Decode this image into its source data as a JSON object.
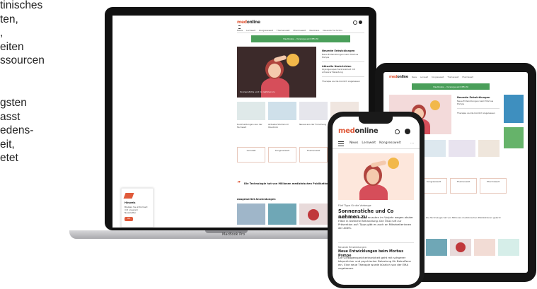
{
  "left_text": {
    "lines_top": [
      "tinisches",
      "ten,",
      ",",
      "eiten",
      "ssourcen"
    ],
    "lines_bottom": [
      "gsten",
      "asst",
      "edens-",
      "eit,",
      "etet"
    ]
  },
  "laptop": {
    "brand_a": "med",
    "brand_b": "online",
    "model_label": "MacBook Pro",
    "nav": [
      "News",
      "Lernwelt",
      "Kongresswelt",
      "Themenwelt",
      "Pharmawelt",
      "Webinare",
      "Neueste Fachinfos"
    ],
    "banner_text": "Hautkrebs – Vorsorge wird Pflicht",
    "quote_text": "Die Technologie hat von Millionen medizinischen Publikationen",
    "section_heading": "Ausgewertet Anwendungen",
    "chips": [
      "Lernwelt",
      "Kongresswelt",
      "Themenwelt",
      "Pharmawelt"
    ],
    "popup_title": "Hinweis",
    "popup_button": "OK"
  },
  "tablet": {
    "brand_a": "med",
    "brand_b": "online",
    "banner_text": "Hautkrebs – Vorsorge wird Pflicht",
    "chips": [
      "Kongresswelt",
      "Themenwelt",
      "Pharmawelt"
    ],
    "quote_text": "Die Technologie hat von Millionen medizinischen Publikationen gelernt"
  },
  "phone": {
    "brand_a": "med",
    "brand_b": "online",
    "nav": [
      "News",
      "Lernwelt",
      "Kongresswelt"
    ],
    "kicker": "Fünf Tipps für die Vorbeuge",
    "headline": "Sonnenstiche und Co nehmen zu",
    "body": "Rund 2.500 Personen mussten im Vorjahr wegen akuter Hitze in ärztliche Behandlung. Die ÖGA ruft zur Prävention auf: Tipps gibt es auch an Mitarbeiterinnen der AGES.",
    "kicker2": "Neueste Entwicklungen",
    "headline2": "Neue Entwicklungen beim Morbus Pompe",
    "body2": "Die Glykogenspeicherkrankheit geht mit schwerer körperlicher und psychischer Belastung für Betroffene ein. Eine neue Therapie wurde kürzlich von der EMA zugelassen."
  },
  "colors": {
    "brand_orange": "#e05a3a",
    "banner_green": "#4a9f5a",
    "hero_bg_phone": "#fde7dc",
    "device_black": "#151515"
  }
}
